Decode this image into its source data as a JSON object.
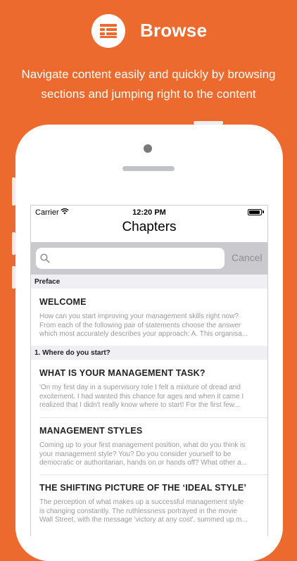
{
  "hero": {
    "title": "Browse",
    "tagline_line1": "Navigate content easily and quickly by browsing",
    "tagline_line2": "sections and jumping right to the content",
    "icon": "list-icon"
  },
  "status_bar": {
    "carrier": "Carrier",
    "time": "12:20 PM"
  },
  "nav": {
    "title": "Chapters"
  },
  "search": {
    "placeholder": "",
    "cancel_label": "Cancel"
  },
  "sections": [
    {
      "header": "Preface",
      "items": [
        {
          "title": "WELCOME",
          "lines": [
            "How can you start improving your management skills right now?",
            "From each of the following pair of statements choose the answer",
            "which most accurately describes your approach: A. This organisa..."
          ]
        }
      ]
    },
    {
      "header": "1. Where do you start?",
      "items": [
        {
          "title": "WHAT IS YOUR MANAGEMENT TASK?",
          "lines": [
            "'On my first day in a supervisory role I felt a mixture of dread and",
            "excitement. I had wanted this chance for ages and when it came I",
            "realized that I didn't really know where to start! For the first few..."
          ]
        },
        {
          "title": "MANAGEMENT STYLES",
          "lines": [
            "Coming up to your first management position, what do you think is",
            "your management style? You? Do you consider yourself to be",
            "democratic or authoritarian, hands on or hands off? What other a..."
          ]
        },
        {
          "title": "THE SHIFTING PICTURE OF THE ‘IDEAL STYLE’",
          "lines": [
            "The perception of what makes up a successful management style",
            "is changing constantly. The ruthlessness portrayed in the movie",
            "Wall Street, with the message 'victory at any cost', summed up m..."
          ]
        }
      ]
    }
  ]
}
